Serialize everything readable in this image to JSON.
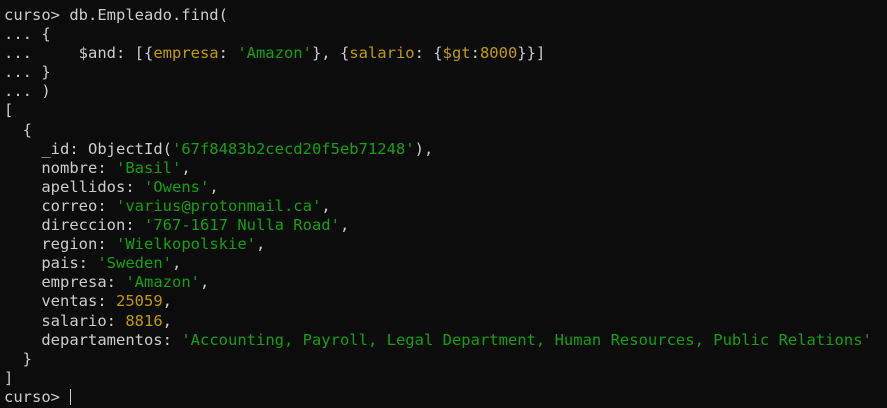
{
  "terminal": {
    "prompt": "curso> ",
    "command": "db.Empleado.find(",
    "cont": "... ",
    "q": {
      "brace_open": "{",
      "indent": "    ",
      "and_key": "$and",
      "and_sep": ": [{",
      "empresa_key": "empresa",
      "colon": ": ",
      "empresa_val": "'Amazon'",
      "mid": "}, {",
      "salario_key": "salario",
      "colon_brace": ": {",
      "gt_key": "$gt",
      "gt_colon": ":",
      "gt_val": "8000",
      "close": "}}]",
      "brace_close": "}",
      "paren_close": ")"
    },
    "result": {
      "open_bracket": "[",
      "open_brace": "  {",
      "fields": [
        {
          "key": "_id",
          "sep": ": ObjectId(",
          "value": "'67f8483b2cecd20f5eb71248'",
          "suffix": "),",
          "type": "string"
        },
        {
          "key": "nombre",
          "sep": ": ",
          "value": "'Basil'",
          "suffix": ",",
          "type": "string"
        },
        {
          "key": "apellidos",
          "sep": ": ",
          "value": "'Owens'",
          "suffix": ",",
          "type": "string"
        },
        {
          "key": "correo",
          "sep": ": ",
          "value": "'varius@protonmail.ca'",
          "suffix": ",",
          "type": "string"
        },
        {
          "key": "direccion",
          "sep": ": ",
          "value": "'767-1617 Nulla Road'",
          "suffix": ",",
          "type": "string"
        },
        {
          "key": "region",
          "sep": ": ",
          "value": "'Wielkopolskie'",
          "suffix": ",",
          "type": "string"
        },
        {
          "key": "pais",
          "sep": ": ",
          "value": "'Sweden'",
          "suffix": ",",
          "type": "string"
        },
        {
          "key": "empresa",
          "sep": ": ",
          "value": "'Amazon'",
          "suffix": ",",
          "type": "string"
        },
        {
          "key": "ventas",
          "sep": ": ",
          "value": "25059",
          "suffix": ",",
          "type": "number"
        },
        {
          "key": "salario",
          "sep": ": ",
          "value": "8816",
          "suffix": ",",
          "type": "number"
        },
        {
          "key": "departamentos",
          "sep": ": ",
          "value": "'Accounting, Payroll, Legal Department, Human Resources, Public Relations'",
          "suffix": "",
          "type": "string"
        }
      ],
      "close_brace": "  }",
      "close_bracket": "]"
    },
    "final_prompt": "curso> "
  },
  "colors": {
    "background": "#0c0c0c",
    "text": "#cccccc",
    "string": "#13a10e",
    "number": "#c19c00"
  }
}
